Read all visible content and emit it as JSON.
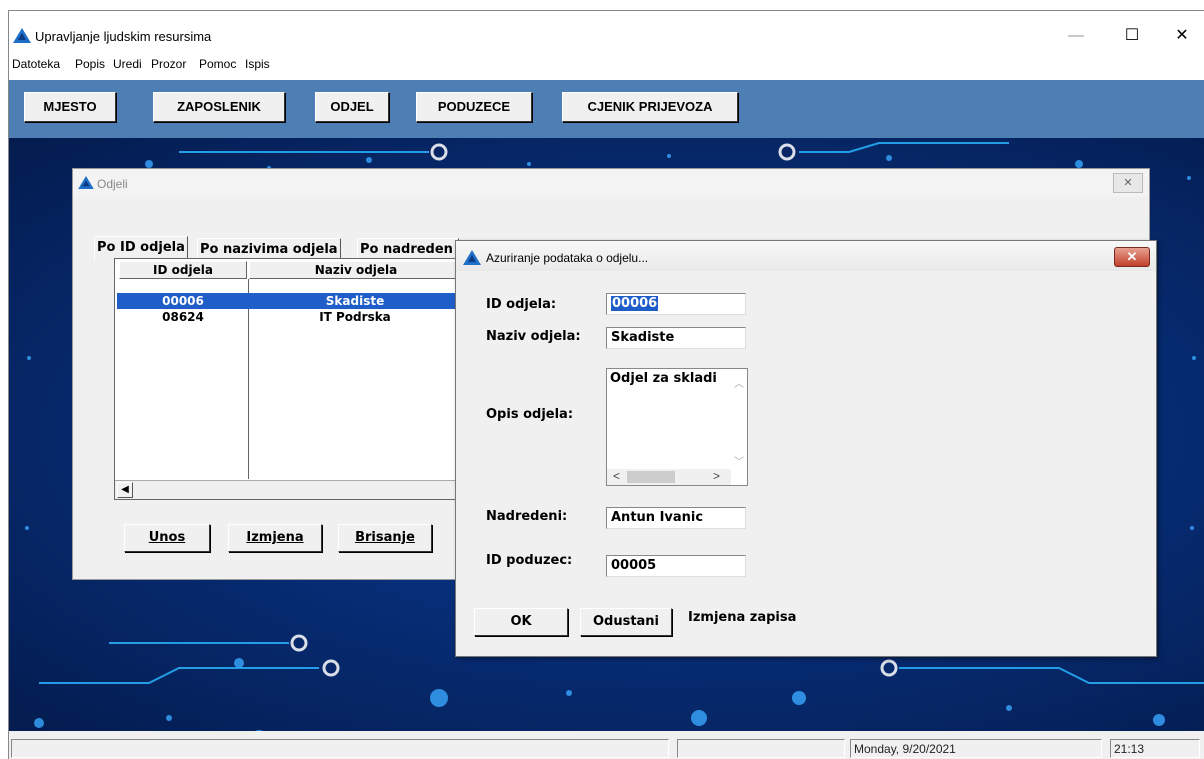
{
  "window": {
    "title": "Upravljanje ljudskim resursima",
    "minimize": "—",
    "maximize": "☐",
    "close": "✕"
  },
  "menu": [
    "Datoteka",
    "Popis",
    "Uredi",
    "Prozor",
    "Pomoc",
    "Ispis"
  ],
  "toolbar": [
    "MJESTO",
    "ZAPOSLENIK",
    "ODJEL",
    "PODUZECE",
    "CJENIK PRIJEVOZA"
  ],
  "colors": {
    "toolbar": "#4d7fb4",
    "background": "#072e78",
    "selection": "#1f5ec8"
  },
  "odjeli": {
    "title": "Odjeli",
    "tabs": [
      "Po ID odjela",
      "Po nazivima odjela",
      "Po nadreden"
    ],
    "columns": [
      "ID odjela",
      "Naziv odjela"
    ],
    "rows": [
      {
        "id": "00006",
        "naziv": "Skadiste",
        "selected": true
      },
      {
        "id": "08624",
        "naziv": "IT Podrska",
        "selected": false
      }
    ],
    "buttons": {
      "unos": "Unos",
      "izmjena": "Izmjena",
      "brisanje": "Brisanje"
    }
  },
  "dialog": {
    "title": "Azuriranje podataka o odjelu...",
    "fields": {
      "id_label": "ID odjela:",
      "id_value": "00006",
      "naziv_label": "Naziv odjela:",
      "naziv_value": "Skadiste",
      "opis_label": "Opis odjela:",
      "opis_value": "Odjel za skladi",
      "nadredeni_label": "Nadredeni:",
      "nadredeni_value": "Antun Ivanic",
      "poduzece_label": "ID poduzec:",
      "poduzece_value": "00005"
    },
    "buttons": {
      "ok": "OK",
      "odustani": "Odustani"
    },
    "status": "Izmjena zapisa"
  },
  "statusbar": {
    "date": "Monday, 9/20/2021",
    "time": "21:13"
  }
}
